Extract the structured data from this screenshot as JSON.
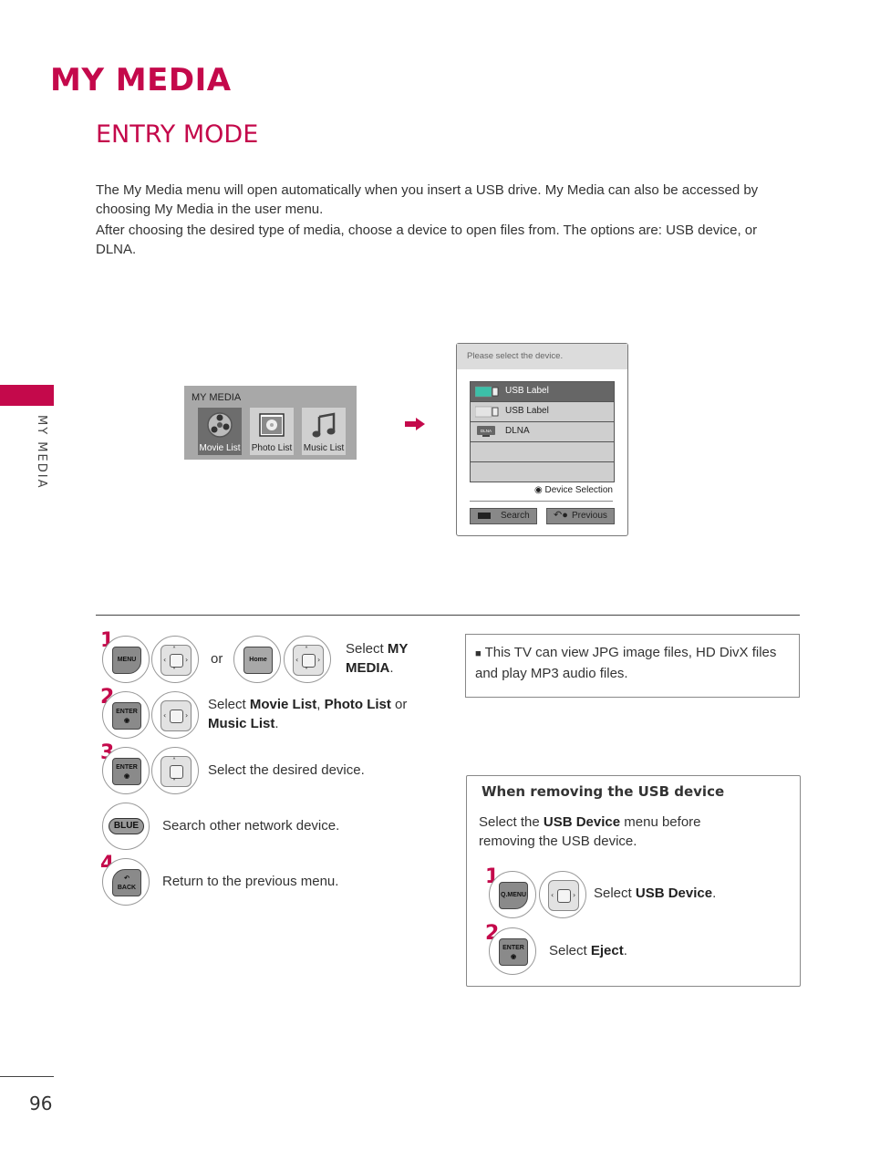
{
  "page": {
    "title": "MY MEDIA",
    "subtitle": "ENTRY MODE",
    "side_label": "MY MEDIA",
    "page_number": "96",
    "accent_color": "#c4094b"
  },
  "intro": {
    "p1": "The My Media menu will open automatically when you insert a USB drive. My Media can also be accessed by choosing My Media in the user menu.",
    "p2": "After choosing the desired type of media, choose a device to open files from. The options are: USB device, or DLNA."
  },
  "my_media_menu": {
    "title": "MY MEDIA",
    "items": [
      {
        "label": "Movie List",
        "icon": "film-reel-icon",
        "selected": true
      },
      {
        "label": "Photo List",
        "icon": "photo-icon",
        "selected": false
      },
      {
        "label": "Music List",
        "icon": "music-note-icon",
        "selected": false
      }
    ]
  },
  "device_dialog": {
    "header": "Please select the device.",
    "devices": [
      {
        "label": "USB Label",
        "icon": "usb-icon",
        "selected": true
      },
      {
        "label": "USB Label",
        "icon": "usb-icon",
        "selected": false
      },
      {
        "label": "DLNA",
        "icon": "dlna-icon",
        "selected": false
      },
      {
        "label": "",
        "icon": "",
        "selected": false
      },
      {
        "label": "",
        "icon": "",
        "selected": false
      }
    ],
    "dlna_icon_text": "DLNA",
    "device_selection": "Device Selection",
    "search_label": "Search",
    "previous_label": "Previous"
  },
  "steps": {
    "s1": {
      "num": "1",
      "key1": "MENU",
      "or": "or",
      "key2": "Home",
      "text_pre": "Select ",
      "text_bold": "MY MEDIA",
      "text_post": "."
    },
    "s2": {
      "num": "2",
      "key": "ENTER",
      "text_pre": "Select ",
      "b1": "Movie List",
      "sep1": ", ",
      "b2": "Photo List",
      "sep2": " or ",
      "b3": "Music List",
      "text_post": "."
    },
    "s3": {
      "num": "3",
      "key": "ENTER",
      "text": "Select the desired device."
    },
    "blue": {
      "key": "BLUE",
      "text": "Search other network device."
    },
    "s4": {
      "num": "4",
      "key": "BACK",
      "text": "Return to the previous menu."
    }
  },
  "note": {
    "bullet": "■",
    "text": "This TV can view JPG image files, HD DivX files and play MP3 audio files."
  },
  "usb_removal": {
    "title": "When removing the USB device",
    "desc_pre": "Select the ",
    "desc_bold": "USB Device",
    "desc_post": " menu before removing the USB device.",
    "s1": {
      "num": "1",
      "key": "Q.MENU",
      "text_pre": "Select ",
      "text_bold": "USB Device",
      "text_post": "."
    },
    "s2": {
      "num": "2",
      "key": "ENTER",
      "text_pre": "Select ",
      "text_bold": "Eject",
      "text_post": "."
    }
  }
}
